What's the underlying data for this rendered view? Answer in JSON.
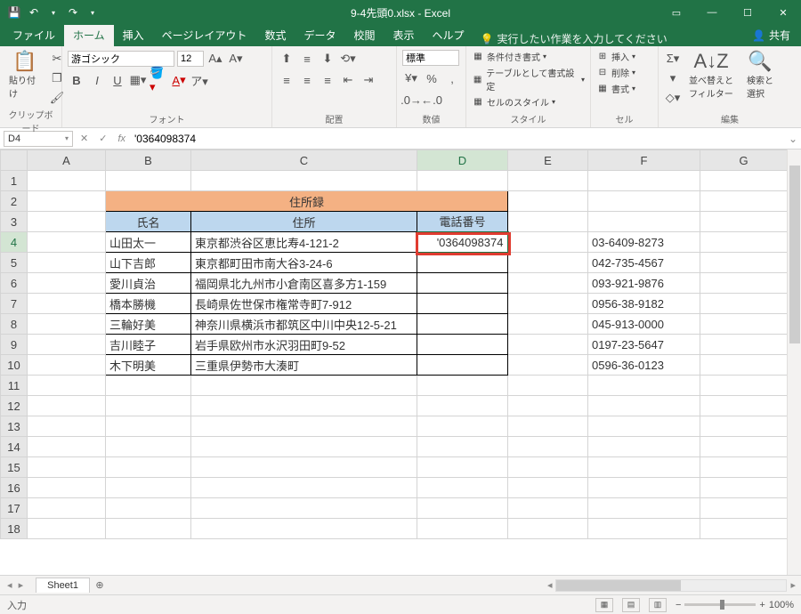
{
  "title": "9-4先頭0.xlsx - Excel",
  "qat": {
    "save": "💾",
    "undo": "↶",
    "redo": "↷"
  },
  "winbtns": {
    "ribbon": "▭",
    "min": "—",
    "max": "☐",
    "close": "✕"
  },
  "tabs": [
    "ファイル",
    "ホーム",
    "挿入",
    "ページレイアウト",
    "数式",
    "データ",
    "校閲",
    "表示",
    "ヘルプ"
  ],
  "active_tab": 1,
  "tellme": {
    "icon": "💡",
    "text": "実行したい作業を入力してください"
  },
  "share": {
    "icon": "👤",
    "text": "共有"
  },
  "ribbon": {
    "clipboard": {
      "paste": "貼り付け",
      "paste_icon": "📋",
      "label": "クリップボード"
    },
    "font": {
      "name": "游ゴシック",
      "size": "12",
      "bold": "B",
      "italic": "I",
      "underline": "U",
      "label": "フォント"
    },
    "alignment": {
      "label": "配置"
    },
    "number": {
      "format": "標準",
      "label": "数値"
    },
    "styles": {
      "cond": "条件付き書式",
      "table": "テーブルとして書式設定",
      "cell": "セルのスタイル",
      "label": "スタイル"
    },
    "cells": {
      "insert": "挿入",
      "delete": "削除",
      "format": "書式",
      "label": "セル"
    },
    "editing": {
      "sort": "並べ替えと\nフィルター",
      "find": "検索と\n選択",
      "label": "編集"
    }
  },
  "namebox": "D4",
  "formula": "'0364098374",
  "columns": [
    "A",
    "B",
    "C",
    "D",
    "E",
    "F",
    "G"
  ],
  "table": {
    "title": "住所録",
    "headers": [
      "氏名",
      "住所",
      "電話番号"
    ],
    "rows": [
      {
        "name": "山田太一",
        "addr": "東京都渋谷区恵比寿4-121-2",
        "tel": "'0364098374",
        "f": "03-6409-8273"
      },
      {
        "name": "山下吉郎",
        "addr": "東京都町田市南大谷3-24-6",
        "tel": "",
        "f": "042-735-4567"
      },
      {
        "name": "愛川貞治",
        "addr": "福岡県北九州市小倉南区喜多方1-159",
        "tel": "",
        "f": "093-921-9876"
      },
      {
        "name": "橋本勝機",
        "addr": "長崎県佐世保市権常寺町7-912",
        "tel": "",
        "f": "0956-38-9182"
      },
      {
        "name": "三輪好美",
        "addr": "神奈川県横浜市都筑区中川中央12-5-21",
        "tel": "",
        "f": "045-913-0000"
      },
      {
        "name": "吉川睦子",
        "addr": "岩手県欧州市水沢羽田町9-52",
        "tel": "",
        "f": "0197-23-5647"
      },
      {
        "name": "木下明美",
        "addr": "三重県伊勢市大湊町",
        "tel": "",
        "f": "0596-36-0123"
      }
    ]
  },
  "sheet": {
    "name": "Sheet1",
    "add": "⊕"
  },
  "status": {
    "mode": "入力",
    "zoom": "100%",
    "plus": "+",
    "minus": "−"
  }
}
